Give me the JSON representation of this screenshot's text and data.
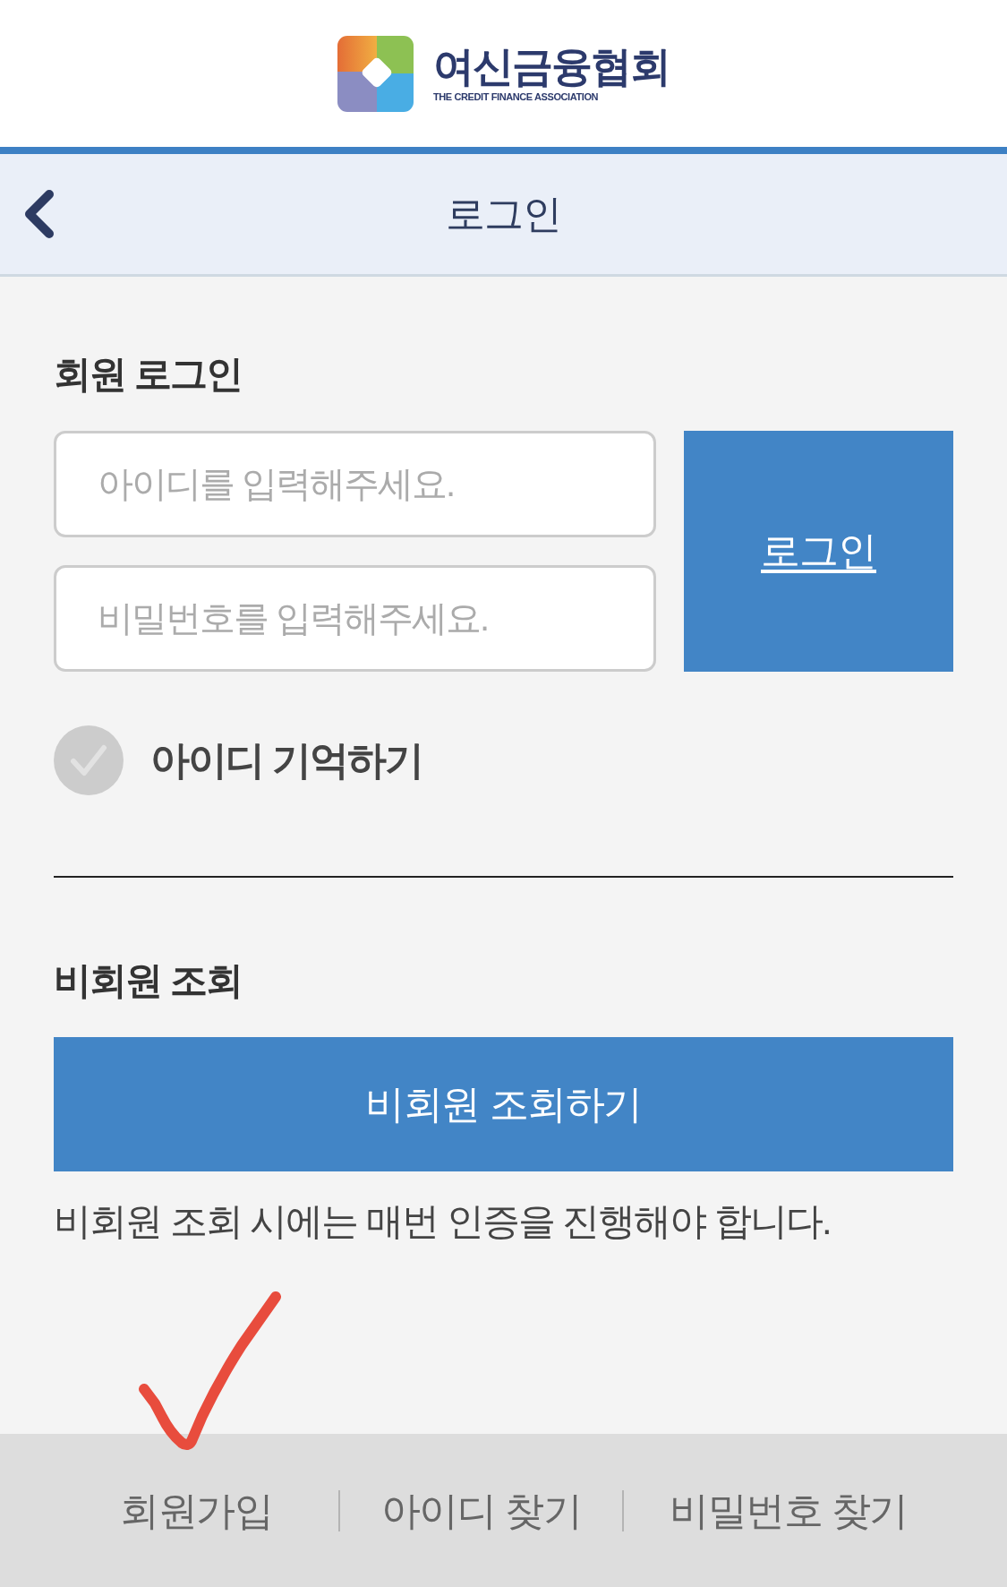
{
  "header": {
    "logo_title": "여신금융협회",
    "logo_subtitle": "THE CREDIT FINANCE ASSOCIATION"
  },
  "nav": {
    "title": "로그인"
  },
  "member_login": {
    "heading": "회원 로그인",
    "id_field": {
      "placeholder": "아이디를 입력해주세요."
    },
    "password_field": {
      "placeholder": "비밀번호를 입력해주세요."
    },
    "login_button": "로그인",
    "remember_id": {
      "label": "아이디 기억하기",
      "checked": false
    }
  },
  "guest_lookup": {
    "heading": "비회원 조회",
    "button": "비회원 조회하기",
    "note": "비회원 조회 시에는 매번 인증을 진행해야 합니다."
  },
  "footer_links": [
    "회원가입",
    "아이디 찾기",
    "비밀번호 찾기"
  ]
}
